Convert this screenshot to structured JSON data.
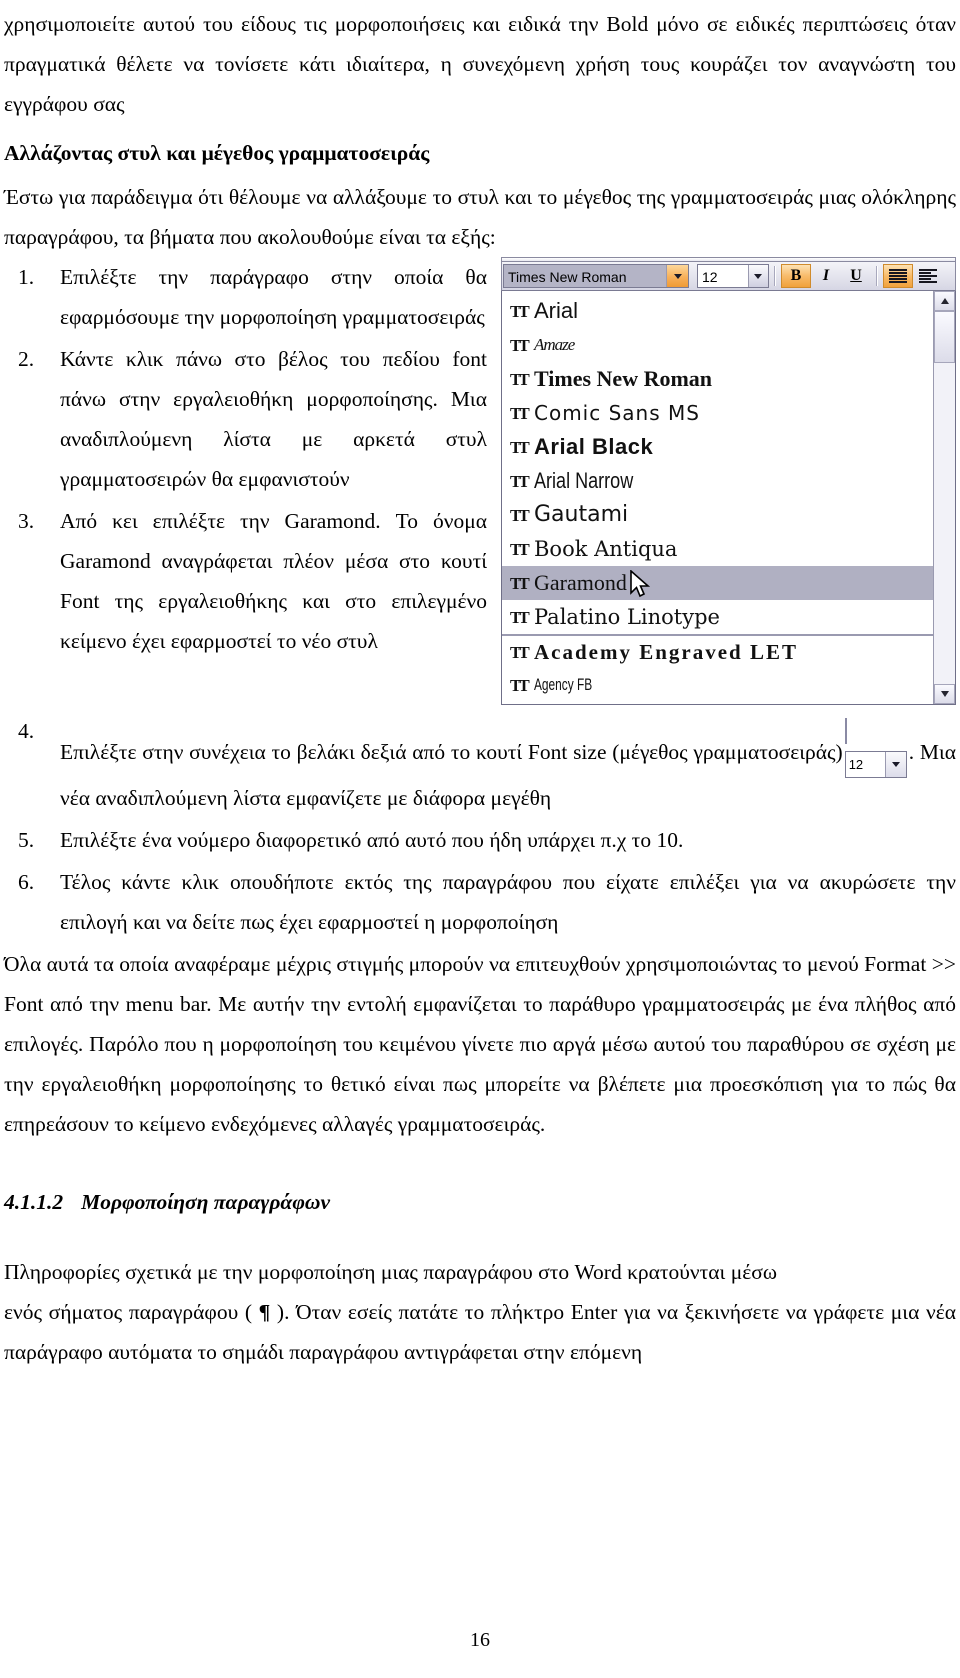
{
  "document": {
    "page_number": "16",
    "intro_paragraph": "χρησιμοποιείτε αυτού του είδους τις μορφοποιήσεις και ειδικά την Bold μόνο σε ειδικές περιπτώσεις όταν πραγματικά θέλετε να τονίσετε κάτι ιδιαίτερα, η συνεχόμενη χρήση τους κουράζει τον αναγνώστη του εγγράφου σας",
    "heading_font_style": "Αλλάζοντας στυλ και μέγεθος γραμματοσειράς",
    "intro_steps": "Έστω για παράδειγμα ότι θέλουμε να αλλάξουμε το στυλ και το μέγεθος της γραμματοσειράς μιας ολόκληρης παραγράφου, τα βήματα που ακολουθούμε είναι τα εξής:",
    "steps": [
      {
        "num": "1.",
        "text": "Επιλέξτε την παράγραφο στην οποία θα εφαρμόσουμε την μορφοποίηση γραμματοσειράς"
      },
      {
        "num": "2.",
        "text": "Κάντε κλικ πάνω στο βέλος του πεδίου font πάνω στην εργαλειοθήκη μορφοποίησης. Μια αναδιπλούμενη λίστα με αρκετά στυλ γραμματοσειρών θα εμφανιστούν"
      },
      {
        "num": "3.",
        "text": "Από κει επιλέξτε την Garamond. Το όνομα Garamond αναγράφεται πλέον μέσα στο κουτί Font της εργαλειοθήκης και στο επιλεγμένο κείμενο έχει εφαρμοστεί το νέο στυλ"
      }
    ],
    "step4": {
      "num": "4.",
      "text_before": "Επιλέξτε στην συνέχεια το βελάκι δεξιά από το κουτί Font size (μέγεθος γραμματοσειράς)",
      "text_after": ". Μια νέα αναδιπλούμενη λίστα εμφανίζετε με διάφορα μεγέθη",
      "inline_size_value": "12"
    },
    "step5": {
      "num": "5.",
      "text": "Επιλέξτε ένα νούμερο διαφορετικό από αυτό που ήδη υπάρχει π.χ το 10."
    },
    "step6": {
      "num": "6.",
      "text": "Τέλος κάντε κλικ οπουδήποτε εκτός της παραγράφου που είχατε επιλέξει για να ακυρώσετε την επιλογή και να δείτε πως έχει εφαρμοστεί η μορφοποίηση"
    },
    "paragraph_format_menu": "Όλα αυτά τα οποία αναφέραμε μέχρις στιγμής μπορούν να επιτευχθούν χρησιμοποιώντας το μενού  Format >> Font από την menu bar. Με αυτήν την εντολή εμφανίζεται το παράθυρο γραμματοσειράς με ένα πλήθος από επιλογές. Παρόλο που η μορφοποίηση του κειμένου γίνετε πιο αργά μέσω αυτού του παραθύρου σε σχέση με την εργαλειοθήκη μορφοποίησης  το θετικό είναι πως μπορείτε να βλέπετε μια προεσκόπιση για το πώς θα επηρεάσουν το κείμενο ενδεχόμενες αλλαγές γραμματοσειράς.",
    "section": {
      "number": "4.1.1.2",
      "title": "Μορφοποίηση παραγράφων"
    },
    "paragraph_final_a": "Πληροφορίες σχετικά με την μορφοποίηση μιας παραγράφου στο Word κρατούνται μέσω",
    "paragraph_final_b_before": "ενός σήματος παραγράφου ( ",
    "paragraph_final_pilcrow": "¶",
    "paragraph_final_b_after": " ). Όταν εσείς πατάτε το πλήκτρο Enter για να ξεκινήσετε να γράφετε μια νέα παράγραφο αυτόματα το σημάδι παραγράφου αντιγράφεται στην επόμενη"
  },
  "word_screenshot": {
    "toolbar": {
      "font_name_value": "Times New Roman",
      "font_size_value": "12",
      "bold_label": "B",
      "italic_label": "I",
      "underline_label": "U",
      "font_dropdown_arrow_icon": "chevron-down-icon",
      "size_dropdown_arrow_icon": "chevron-down-icon",
      "align_icon": "align-justify-icon"
    },
    "font_list": [
      {
        "label": "Arial",
        "style": "f-arial",
        "selected": false,
        "divider_above": false
      },
      {
        "label": "Amaze",
        "style": "f-amaze",
        "selected": false,
        "divider_above": false
      },
      {
        "label": "Times New Roman",
        "style": "f-times",
        "selected": false,
        "divider_above": false
      },
      {
        "label": "Comic Sans MS",
        "style": "f-comic",
        "selected": false,
        "divider_above": false
      },
      {
        "label": "Arial Black",
        "style": "f-arialblk",
        "selected": false,
        "divider_above": false
      },
      {
        "label": "Arial Narrow",
        "style": "f-narrow",
        "selected": false,
        "divider_above": false
      },
      {
        "label": "Gautami",
        "style": "f-gautami",
        "selected": false,
        "divider_above": false
      },
      {
        "label": "Book Antiqua",
        "style": "f-bookant",
        "selected": false,
        "divider_above": false
      },
      {
        "label": "Garamond",
        "style": "f-garamond",
        "selected": true,
        "divider_above": false
      },
      {
        "label": "Palatino Linotype",
        "style": "f-palatino",
        "selected": false,
        "divider_above": false
      },
      {
        "label": "Academy Engraved LET",
        "style": "f-academy",
        "selected": false,
        "divider_above": true
      },
      {
        "label": "Agency FB",
        "style": "f-agency",
        "selected": false,
        "divider_above": false
      }
    ],
    "truetype_icon": "TT",
    "scrollbar": {
      "up_icon": "scroll-up-arrow-icon",
      "down_icon": "scroll-down-arrow-icon"
    },
    "cursor_icon": "mouse-pointer-icon"
  }
}
